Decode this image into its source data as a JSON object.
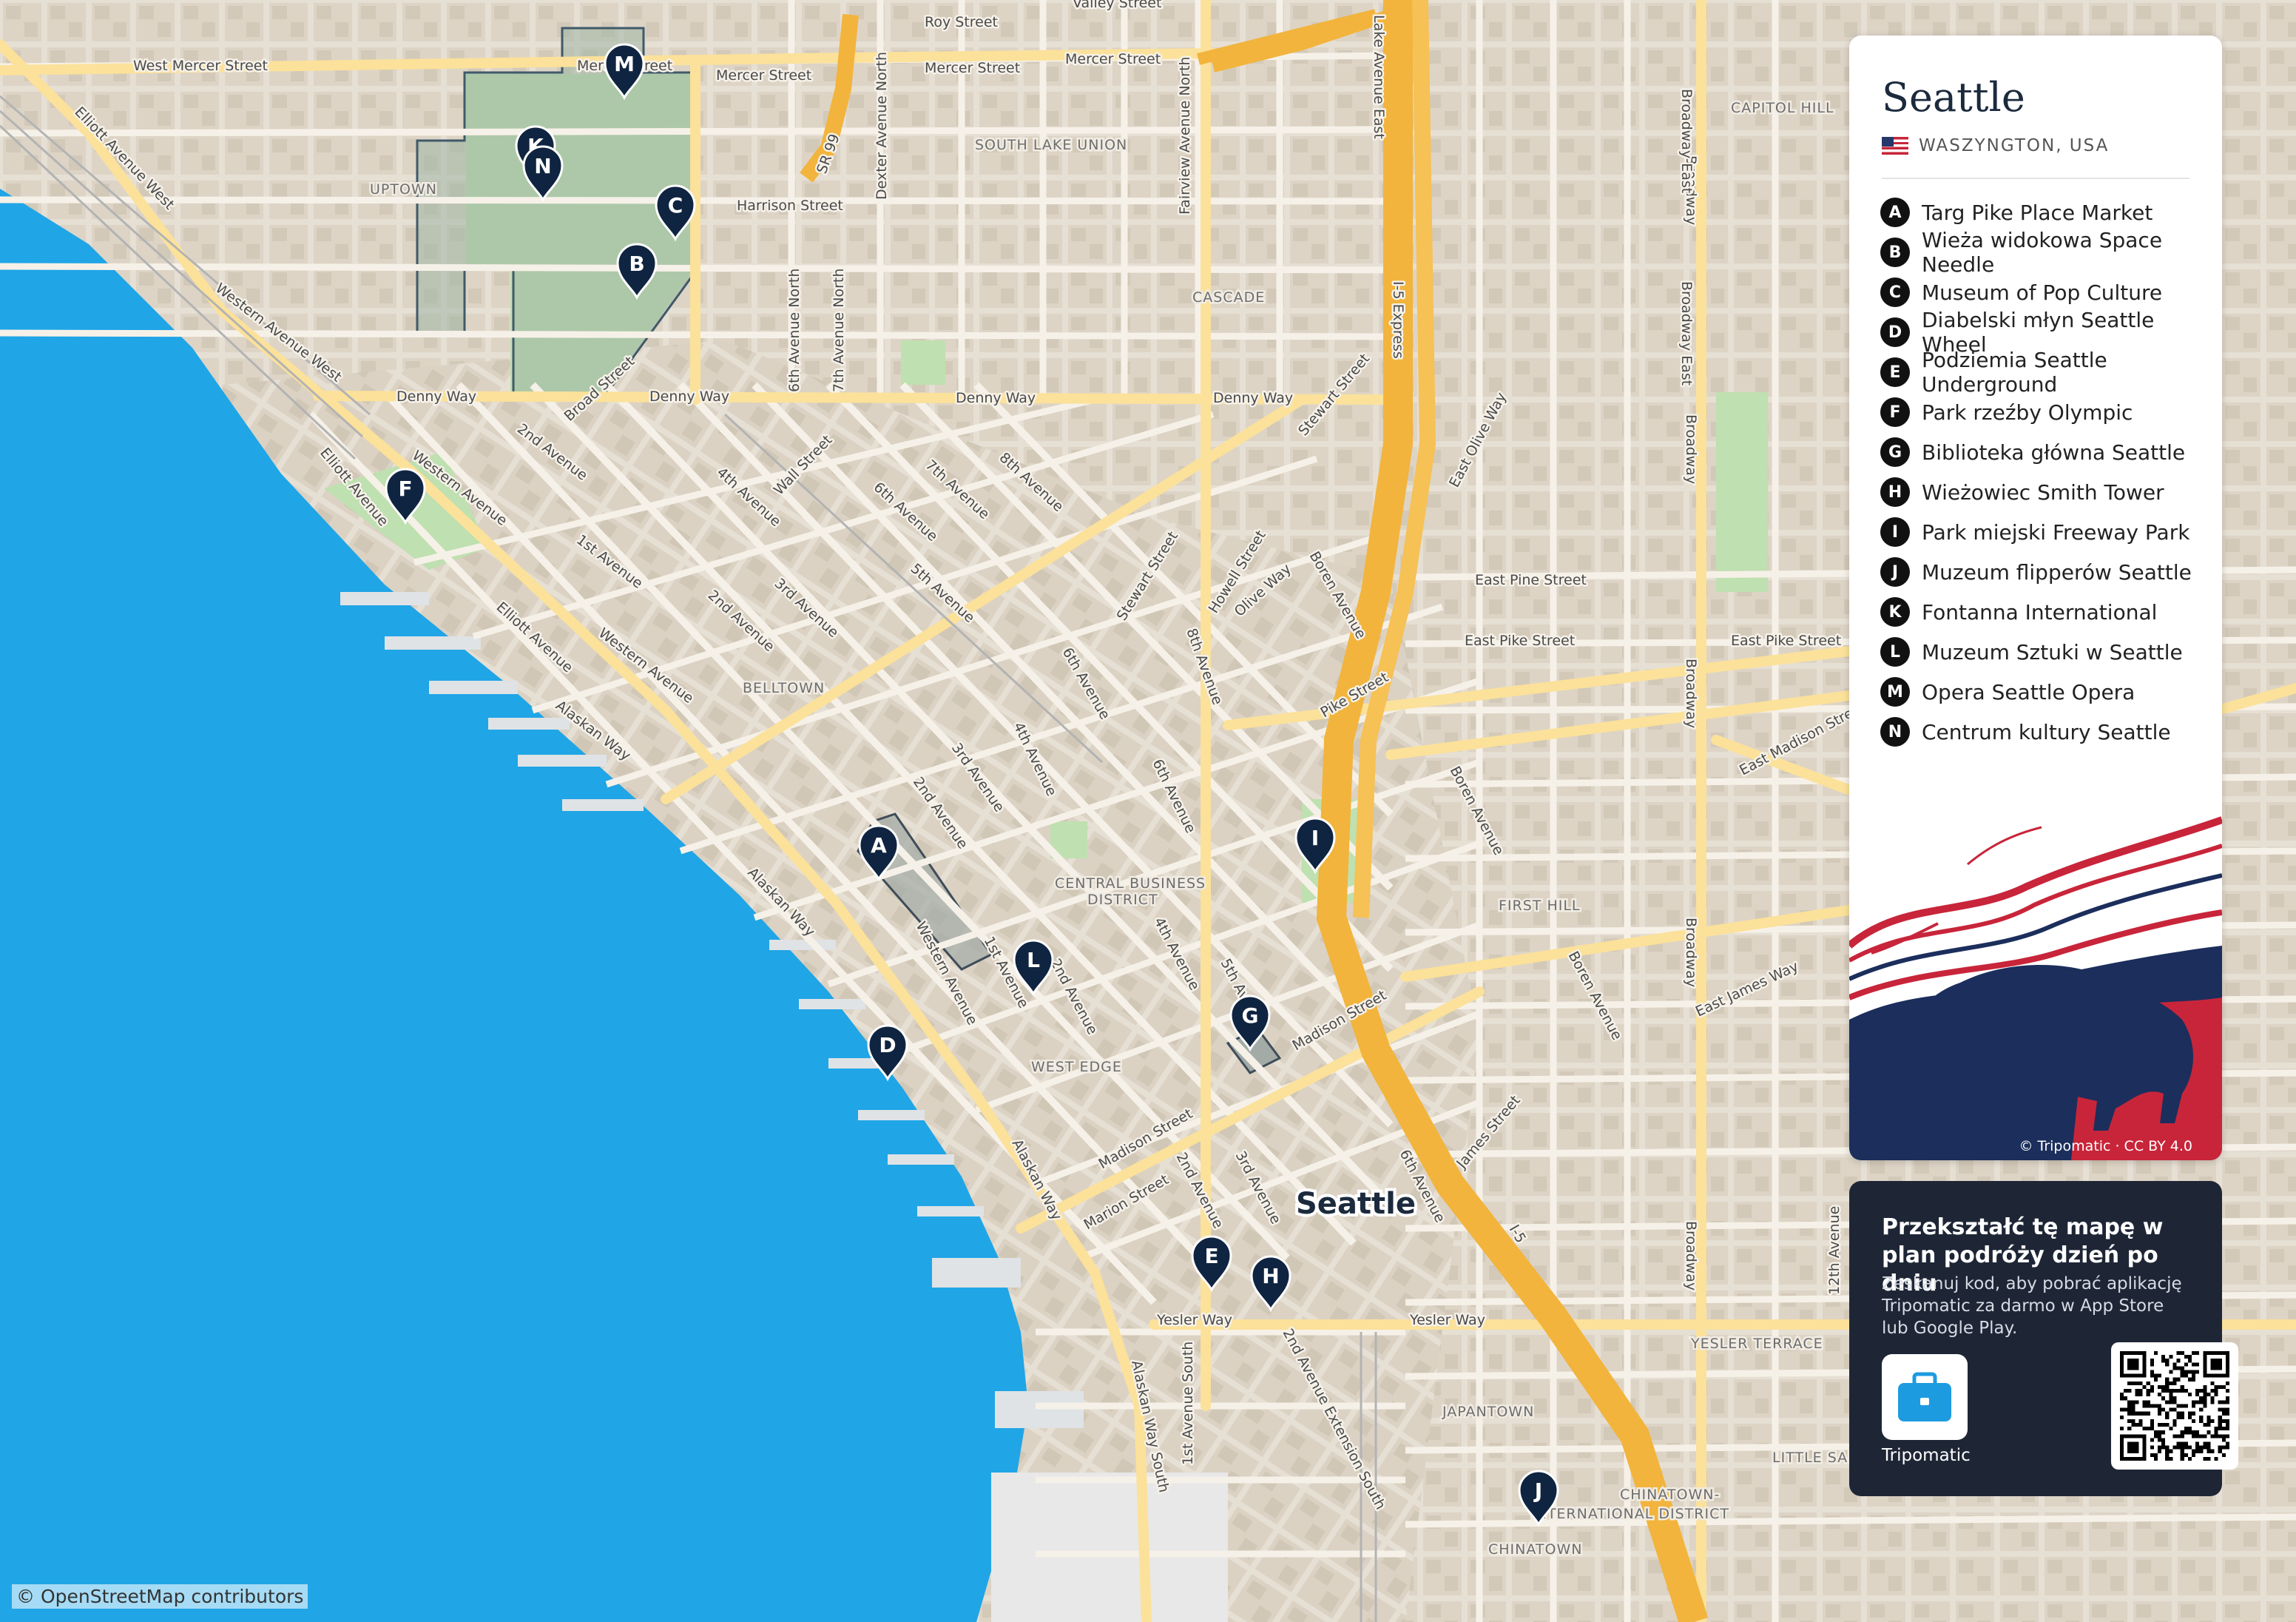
{
  "map": {
    "osm_credit": "© OpenStreetMap contributors",
    "city_label": "Seattle",
    "neighborhoods": [
      "UPTOWN",
      "SOUTH LAKE UNION",
      "CASCADE",
      "CAPITOL HILL",
      "BELLTOWN",
      "CENTRAL BUSINESS",
      "DISTRICT",
      "FIRST HILL",
      "WEST EDGE",
      "YESLER TERRACE",
      "JAPANTOWN",
      "CHINATOWN-",
      "INTERNATIONAL DISTRICT",
      "CHINATOWN",
      "LITTLE SAIGON"
    ],
    "streets": [
      "Roy Street",
      "Valley Street",
      "West Mercer Street",
      "Mercer Street",
      "Mercer Street",
      "Mercer Street",
      "Mercer Street",
      "Harrison Street",
      "Elliott Avenue West",
      "Western Avenue West",
      "Denny Way",
      "Denny Way",
      "Denny Way",
      "Denny Way",
      "Broad Street",
      "2nd Avenue",
      "Elliott Avenue",
      "Western Avenue",
      "1st Avenue",
      "4th Avenue",
      "Wall Street",
      "6th Avenue",
      "7th Avenue",
      "8th Avenue",
      "5th Avenue",
      "2nd Avenue",
      "3rd Avenue",
      "Elliott Avenue",
      "Western Avenue",
      "Alaskan Way",
      "Alaskan Way",
      "6th Avenue",
      "Stewart Street",
      "Howell Street",
      "Olive Way",
      "Boren Avenue",
      "8th Avenue",
      "4th Avenue",
      "3rd Avenue",
      "2nd Avenue",
      "6th Avenue",
      "Pike Street",
      "East Pine Street",
      "East Pike Street",
      "East Pike Street",
      "East Olive Way",
      "Stewart Street",
      "Western Avenue",
      "1st Avenue",
      "2nd Avenue",
      "4th Avenue",
      "5th Avenue",
      "Madison Street",
      "Madison Street",
      "Marion Street",
      "2nd Avenue",
      "3rd Avenue",
      "Alaskan Way",
      "6th Avenue",
      "James Street",
      "Boren Avenue",
      "Boren Avenue",
      "East James Way",
      "East Madison Street",
      "Yesler Way",
      "Yesler Way",
      "Alaskan Way South",
      "1st Avenue South",
      "2nd Avenue Extension South",
      "Broadway",
      "Broadway",
      "Broadway",
      "Broadway",
      "Broadway",
      "Broadway East",
      "Broadway East",
      "Dexter Avenue North",
      "Fairview Avenue North",
      "6th Avenue North",
      "7th Avenue North",
      "Lake Avenue East",
      "12th Avenue",
      "SR 99",
      "I-5 Express",
      "I-5"
    ]
  },
  "markers": [
    {
      "letter": "A"
    },
    {
      "letter": "B"
    },
    {
      "letter": "C"
    },
    {
      "letter": "D"
    },
    {
      "letter": "E"
    },
    {
      "letter": "F"
    },
    {
      "letter": "G"
    },
    {
      "letter": "H"
    },
    {
      "letter": "I"
    },
    {
      "letter": "J"
    },
    {
      "letter": "K"
    },
    {
      "letter": "L"
    },
    {
      "letter": "M"
    },
    {
      "letter": "N"
    }
  ],
  "panel": {
    "title": "Seattle",
    "region": "WASZYNGTON, USA",
    "flag_icon": "us-flag-icon",
    "legend": [
      {
        "letter": "A",
        "label": "Targ Pike Place Market"
      },
      {
        "letter": "B",
        "label": "Wieża widokowa Space Needle"
      },
      {
        "letter": "C",
        "label": "Museum of Pop Culture"
      },
      {
        "letter": "D",
        "label": "Diabelski młyn Seattle Wheel"
      },
      {
        "letter": "E",
        "label": "Podziemia Seattle Underground"
      },
      {
        "letter": "F",
        "label": "Park rzeźby Olympic"
      },
      {
        "letter": "G",
        "label": "Biblioteka główna Seattle"
      },
      {
        "letter": "H",
        "label": "Wieżowiec Smith Tower"
      },
      {
        "letter": "I",
        "label": "Park miejski Freeway Park"
      },
      {
        "letter": "J",
        "label": "Muzeum flipperów Seattle"
      },
      {
        "letter": "K",
        "label": "Fontanna International"
      },
      {
        "letter": "L",
        "label": "Muzeum Sztuki w Seattle"
      },
      {
        "letter": "M",
        "label": "Opera Seattle Opera"
      },
      {
        "letter": "N",
        "label": "Centrum kultury Seattle"
      }
    ],
    "art_credit": "© Tripomatic · CC BY 4.0"
  },
  "promo": {
    "title": "Przekształć tę mapę w plan podróży dzień po dniu",
    "description": "Zeskanuj kod, aby pobrać aplikację Tripomatic za darmo w App Store lub Google Play.",
    "app_name": "Tripomatic",
    "app_icon": "suitcase-icon",
    "qr_icon": "qr-code-icon"
  },
  "colors": {
    "water": "#20a5e6",
    "land": "#e9e3d9",
    "park": "#bfe0b0",
    "highway": "#f2b43c",
    "major_road": "#fbe19a",
    "marker": "#0f2440",
    "promo_bg": "#1e2636",
    "accent_red": "#c8253a",
    "accent_navy": "#1b2e5c"
  }
}
